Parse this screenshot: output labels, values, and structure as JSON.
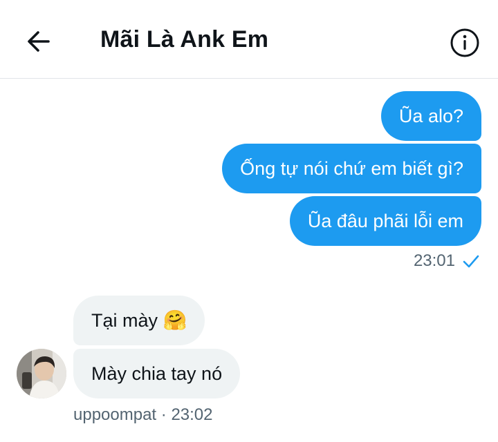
{
  "header": {
    "title": "Mãi Là Ank Em",
    "back_icon": "arrow-left-icon",
    "info_icon": "info-circle-icon"
  },
  "colors": {
    "sent_bubble": "#1d9bf0",
    "received_bubble": "#eff3f4",
    "meta_text": "#536471"
  },
  "sent_messages": [
    {
      "text": "Ũa alo?"
    },
    {
      "text": "Ống tự nói chứ em biết gì?"
    },
    {
      "text": "Ũa đâu phãi lỗi em"
    }
  ],
  "sent_meta": {
    "time": "23:01",
    "status_icon": "check-icon"
  },
  "received_messages": [
    {
      "text": "Tại mày",
      "emoji": "🤗"
    },
    {
      "text": "Mày chia tay nó"
    }
  ],
  "received_meta": {
    "sender": "uppoompat",
    "separator": "·",
    "time": "23:02"
  }
}
